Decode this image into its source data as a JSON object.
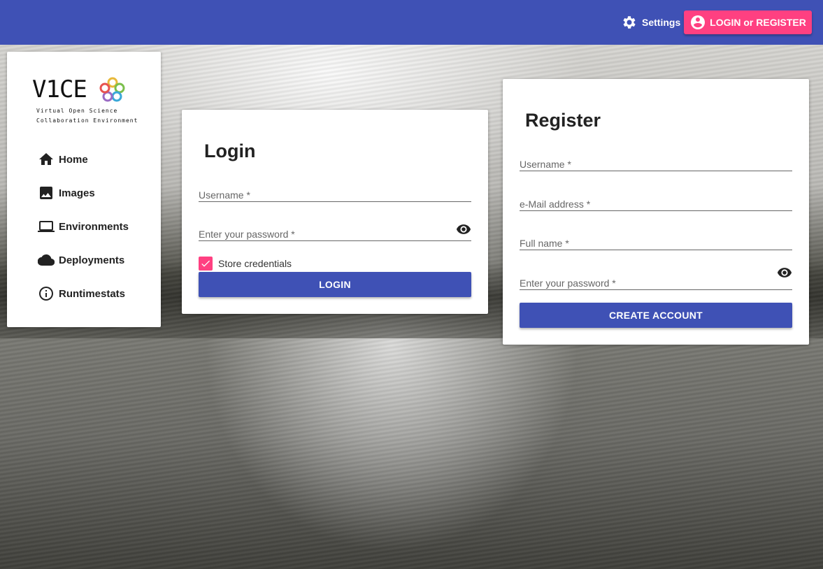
{
  "header": {
    "settings_label": "Settings",
    "login_label": "LOGIN or REGISTER",
    "bar_color": "#3f51b5",
    "accent_color": "#ff4081"
  },
  "sidebar": {
    "logo": {
      "title": "V1CE",
      "subtitle_line1": "Virtual Open Science",
      "subtitle_line2": "Collaboration Environment"
    },
    "items": [
      {
        "label": "Home",
        "icon": "home-icon"
      },
      {
        "label": "Images",
        "icon": "image-icon"
      },
      {
        "label": "Environments",
        "icon": "laptop-icon"
      },
      {
        "label": "Deployments",
        "icon": "cloud-icon"
      },
      {
        "label": "Runtimestats",
        "icon": "info-icon"
      }
    ]
  },
  "login": {
    "title": "Login",
    "username_placeholder": "Username *",
    "password_placeholder": "Enter your password *",
    "store_credentials_label": "Store credentials",
    "store_credentials_checked": true,
    "submit_label": "LOGIN"
  },
  "register": {
    "title": "Register",
    "username_placeholder": "Username *",
    "email_placeholder": "e-Mail address *",
    "fullname_placeholder": "Full name *",
    "password_placeholder": "Enter your password *",
    "submit_label": "CREATE ACCOUNT"
  }
}
